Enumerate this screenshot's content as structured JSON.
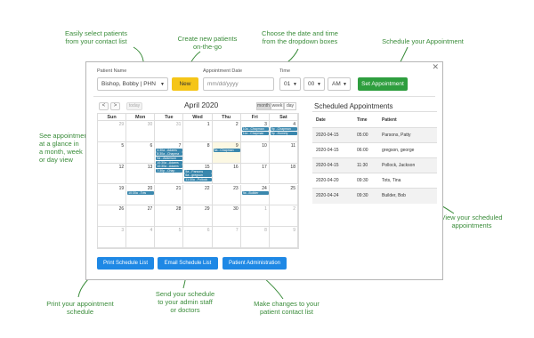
{
  "callouts": {
    "select_patients": "Easily select patients\nfrom your contact list",
    "create_patients": "Create new patients\non-the-go",
    "choose_date": "Choose the date and time\nfrom the dropdown boxes",
    "schedule": "Schedule your Appointment",
    "see_appointments": "See appointments\nat a glance in\na month, week\nor day view",
    "view_scheduled": "View your scheduled\nappointments",
    "print": "Print your appointment\nschedule",
    "send": "Send your schedule\nto your admin staff\nor doctors",
    "changes": "Make changes to your\npatient contact list"
  },
  "form": {
    "patient_name_label": "Patient Name",
    "patient_value": "Bishop, Bobby | PHN",
    "new_button": "New",
    "appt_date_label": "Appointment Date",
    "date_placeholder": "mm/dd/yyyy",
    "time_label": "Time",
    "hour": "01",
    "minute": "00",
    "ampm": "AM",
    "set_button": "Set Appointment"
  },
  "calendar": {
    "prev": "<",
    "next": ">",
    "today": "today",
    "title": "April 2020",
    "views": [
      "month",
      "week",
      "day"
    ],
    "days": [
      "Sun",
      "Mon",
      "Tue",
      "Wed",
      "Thu",
      "Fri",
      "Sat"
    ],
    "weeks": [
      [
        {
          "n": "29",
          "o": true
        },
        {
          "n": "30",
          "o": true
        },
        {
          "n": "31",
          "o": true
        },
        {
          "n": "1"
        },
        {
          "n": "2"
        },
        {
          "n": "3"
        },
        {
          "n": "4"
        }
      ],
      [
        {
          "n": "5"
        },
        {
          "n": "6"
        },
        {
          "n": "7"
        },
        {
          "n": "8"
        },
        {
          "n": "9",
          "hl": true
        },
        {
          "n": "10"
        },
        {
          "n": "11"
        }
      ],
      [
        {
          "n": "12"
        },
        {
          "n": "13"
        },
        {
          "n": "14"
        },
        {
          "n": "15"
        },
        {
          "n": "16"
        },
        {
          "n": "17"
        },
        {
          "n": "18"
        }
      ],
      [
        {
          "n": "19"
        },
        {
          "n": "20"
        },
        {
          "n": "21"
        },
        {
          "n": "22"
        },
        {
          "n": "23"
        },
        {
          "n": "24"
        },
        {
          "n": "25"
        }
      ],
      [
        {
          "n": "26"
        },
        {
          "n": "27"
        },
        {
          "n": "28"
        },
        {
          "n": "29"
        },
        {
          "n": "30"
        },
        {
          "n": "1",
          "o": true
        },
        {
          "n": "2",
          "o": true
        }
      ],
      [
        {
          "n": "3",
          "o": true
        },
        {
          "n": "4",
          "o": true
        },
        {
          "n": "5",
          "o": true
        },
        {
          "n": "6",
          "o": true
        },
        {
          "n": "7",
          "o": true
        },
        {
          "n": "8",
          "o": true
        },
        {
          "n": "9",
          "o": true
        }
      ]
    ],
    "events": [
      {
        "week": 0,
        "day": 5,
        "slot": 0,
        "label": "10a ..Chapman"
      },
      {
        "week": 0,
        "day": 6,
        "slot": 0,
        "label": "9p ..Chapman"
      },
      {
        "week": 0,
        "day": 5,
        "slot": 1,
        "label": "11a ..Chapman"
      },
      {
        "week": 0,
        "day": 6,
        "slot": 1,
        "label": "9p ..Homely"
      },
      {
        "week": 1,
        "day": 2,
        "slot": 0,
        "label": "4:30a ..Adams"
      },
      {
        "week": 1,
        "day": 2,
        "slot": 1,
        "label": "8:30a ..Chapma"
      },
      {
        "week": 1,
        "day": 2,
        "slot": 2,
        "label": "9a ..Adamson"
      },
      {
        "week": 1,
        "day": 2,
        "slot": 3,
        "label": "10:30a ..Adams"
      },
      {
        "week": 1,
        "day": 2,
        "slot": 4,
        "label": "10:30a ..Adams"
      },
      {
        "week": 1,
        "day": 2,
        "slot": 5,
        "label": "7:30p ..Chap"
      },
      {
        "week": 1,
        "day": 4,
        "slot": 0,
        "label": "5a ..Chapman"
      },
      {
        "week": 2,
        "day": 3,
        "slot": 0,
        "label": "5a ..Parsons"
      },
      {
        "week": 2,
        "day": 3,
        "slot": 1,
        "label": "6a ..gregson"
      },
      {
        "week": 2,
        "day": 3,
        "slot": 2,
        "label": "11:30a ..Pollock"
      },
      {
        "week": 3,
        "day": 1,
        "slot": 0,
        "label": "10:30a ..Tots"
      },
      {
        "week": 3,
        "day": 5,
        "slot": 0,
        "label": "9a ..Builder"
      }
    ]
  },
  "scheduled": {
    "title": "Scheduled Appointments",
    "columns": [
      "Date",
      "Time",
      "Patient"
    ],
    "rows": [
      [
        "2020-04-15",
        "05:00",
        "Parsons, Patty"
      ],
      [
        "2020-04-15",
        "06:00",
        "gregson, george"
      ],
      [
        "2020-04-15",
        "11:30",
        "Pollock, Jackson"
      ],
      [
        "2020-04-20",
        "09:30",
        "Tots, Tina"
      ],
      [
        "2020-04-24",
        "09:30",
        "Builder, Bob"
      ]
    ]
  },
  "buttons": {
    "print": "Print Schedule List",
    "email": "Email Schedule List",
    "admin": "Patient Administration"
  },
  "icons": {
    "close": "close-icon",
    "dropdown": "chevron-down-icon"
  },
  "colors": {
    "accent_blue": "#1e88e5",
    "event_blue": "#3a87ad",
    "new_yellow": "#f5c518",
    "set_green": "#2e9e3e",
    "callout_green": "#3a8c3a"
  }
}
